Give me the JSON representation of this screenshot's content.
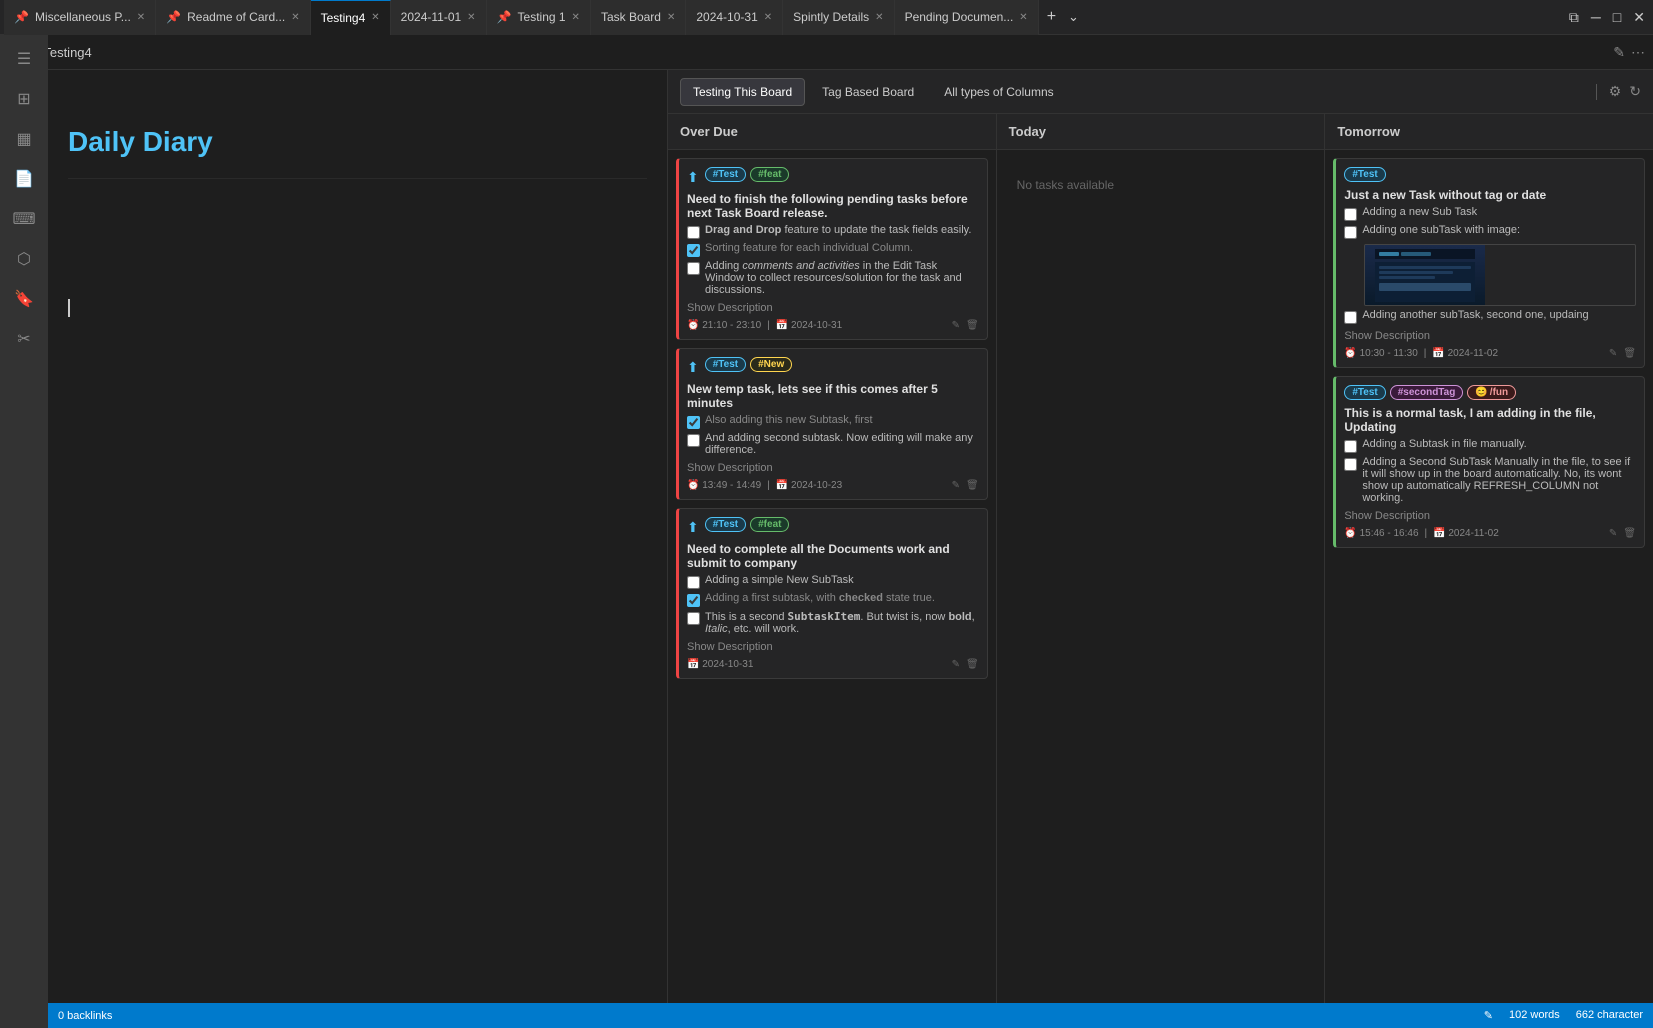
{
  "tabs": [
    {
      "label": "Miscellaneous P...",
      "pinned": true,
      "active": false
    },
    {
      "label": "Readme of Card...",
      "pinned": true,
      "active": false
    },
    {
      "label": "Testing4",
      "pinned": false,
      "active": true
    },
    {
      "label": "2024-11-01",
      "pinned": false,
      "active": false
    },
    {
      "label": "Testing 1",
      "pinned": true,
      "active": false
    },
    {
      "label": "Task Board",
      "pinned": false,
      "active": false
    },
    {
      "label": "2024-10-31",
      "pinned": false,
      "active": false
    },
    {
      "label": "Spintly Details",
      "pinned": false,
      "active": false
    },
    {
      "label": "Pending Documen...",
      "pinned": false,
      "active": false
    }
  ],
  "breadcrumb": {
    "title": "Testing4",
    "edit_icon": "✎",
    "more_icon": "⋯"
  },
  "editor": {
    "title": "Daily Diary"
  },
  "board": {
    "title": "Task Board",
    "tabs": [
      {
        "label": "Testing This Board",
        "active": true
      },
      {
        "label": "Tag Based Board",
        "active": false
      },
      {
        "label": "All types of Columns",
        "active": false
      }
    ],
    "settings_icon": "⚙",
    "refresh_icon": "↻",
    "columns": [
      {
        "name": "Over Due",
        "cards": [
          {
            "priority": "↑",
            "tags": [
              {
                "label": "#Test",
                "type": "test"
              },
              {
                "label": "#feat",
                "type": "feat"
              }
            ],
            "title": "Need to finish the following pending tasks before next Task Board release.",
            "subtasks": [
              {
                "checked": false,
                "text": "Drag and Drop",
                "textExtra": " feature to update the task fields easily.",
                "bold": "Drag and Drop"
              },
              {
                "checked": true,
                "text": "Sorting feature for each individual Column."
              },
              {
                "checked": false,
                "text": "Adding ",
                "textExtra": "comments and activities",
                "italic": "comments and activities",
                "textAfter": " in the Edit Task Window to collect resources/solution for the task and discussions."
              }
            ],
            "show_desc": "Show Description",
            "time": "21:10 - 23:10",
            "date": "2024-10-31",
            "border_color": "#e44"
          },
          {
            "priority": "↑",
            "tags": [
              {
                "label": "#Test",
                "type": "test"
              },
              {
                "label": "#New",
                "type": "new"
              }
            ],
            "title": "New temp task, lets see if this comes after 5 minutes",
            "subtasks": [
              {
                "checked": true,
                "text": "Also adding this new Subtask, first"
              },
              {
                "checked": false,
                "text": "And adding second subtask. Now editing will make any difference."
              }
            ],
            "show_desc": "Show Description",
            "time": "13:49 - 14:49",
            "date": "2024-10-23",
            "border_color": "#e44"
          },
          {
            "priority": "↑",
            "tags": [
              {
                "label": "#Test",
                "type": "test"
              },
              {
                "label": "#feat",
                "type": "feat"
              }
            ],
            "title": "Need to complete all the Documents work and submit to company",
            "subtasks": [
              {
                "checked": false,
                "text": "Adding a simple New SubTask"
              },
              {
                "checked": true,
                "text": "Adding a first subtask, with ",
                "boldAfter": "checked",
                "textAfter": " state true."
              },
              {
                "checked": false,
                "text": "This is a second ",
                "codeText": "SubtaskItem",
                "textAfter": ". But twist is, now ",
                "bold2": "bold",
                "italic2": "Italic",
                "textEnd": ", etc. will work."
              }
            ],
            "show_desc": "Show Description",
            "date": "2024-10-31",
            "border_color": "#e44"
          }
        ]
      },
      {
        "name": "Today",
        "no_tasks": "No tasks available",
        "cards": []
      },
      {
        "name": "Tomorrow",
        "cards": [
          {
            "priority": null,
            "tags": [
              {
                "label": "#Test",
                "type": "test"
              }
            ],
            "title": "Just a new Task without tag or date",
            "subtasks": [
              {
                "checked": false,
                "text": "Adding a new Sub Task"
              },
              {
                "checked": false,
                "text": "Adding one subTask with image:",
                "has_image": true
              },
              {
                "checked": false,
                "text": "Adding another subTask, second one, updaing"
              }
            ],
            "show_desc": "Show Description",
            "time": "10:30 - 11:30",
            "date": "2024-11-02",
            "border_color": "#66bb6a"
          },
          {
            "priority": null,
            "tags": [
              {
                "label": "#Test",
                "type": "test"
              },
              {
                "label": "#secondTag",
                "type": "secondtag"
              },
              {
                "label": "😊/fun",
                "type": "fun"
              }
            ],
            "title": "This is a normal task, I am adding in the file, Updating",
            "subtasks": [
              {
                "checked": false,
                "text": "Adding a Subtask in file manually."
              },
              {
                "checked": false,
                "text": "Adding a Second SubTask Manually in the file, to see if it will show up in the board automatically. No, its wont show up automatically REFRESH_COLUMN not working."
              }
            ],
            "show_desc": "Show Description",
            "time": "15:46 - 16:46",
            "date": "2024-11-02",
            "border_color": "#66bb6a"
          }
        ]
      }
    ]
  },
  "status_bar": {
    "backlinks": "0 backlinks",
    "pencil_icon": "✎",
    "words": "102 words",
    "chars": "662 character"
  }
}
